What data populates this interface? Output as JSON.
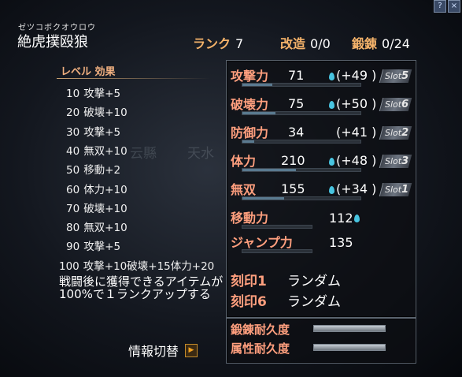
{
  "window": {
    "top_icons": [
      "?",
      "×"
    ],
    "background_text": [
      "天水",
      "云縣"
    ]
  },
  "header": {
    "reading": "ゼツコボクオウロウ",
    "item_name": "絶虎撲殴狼",
    "rank_label": "ランク",
    "rank_value": "7",
    "mod_label": "改造",
    "mod_value": "0/0",
    "forge_label": "鍛錬",
    "forge_value": "0/24"
  },
  "level_effects": {
    "title": "レベル 効果",
    "items": [
      {
        "level": "10",
        "effect": "攻撃+5"
      },
      {
        "level": "20",
        "effect": "破壊+10"
      },
      {
        "level": "30",
        "effect": "攻撃+5"
      },
      {
        "level": "40",
        "effect": "無双+10"
      },
      {
        "level": "50",
        "effect": "移動+2"
      },
      {
        "level": "60",
        "effect": "体力+10"
      },
      {
        "level": "70",
        "effect": "破壊+10"
      },
      {
        "level": "80",
        "effect": "無双+10"
      },
      {
        "level": "90",
        "effect": "攻撃+5"
      },
      {
        "level": "100",
        "effect": "攻撃+10破壊+15体力+20"
      }
    ]
  },
  "description": "戦闘後に獲得できるアイテムが100%で１ランクアップする",
  "info_switch": {
    "label": "情報切替",
    "icon": "arrow-right-icon"
  },
  "stats": [
    {
      "label": "攻撃力",
      "value": "71",
      "bonus": "(+49 )",
      "gem": true,
      "slot": "5",
      "bar": 0.25
    },
    {
      "label": "破壊力",
      "value": "75",
      "bonus": "(+50 )",
      "gem": true,
      "slot": "6",
      "bar": 0.28
    },
    {
      "label": "防御力",
      "value": "34",
      "bonus": "(+41 )",
      "gem": false,
      "slot": "2",
      "bar": 0.1
    },
    {
      "label": "体力",
      "value": "210",
      "bonus": "(+48 )",
      "gem": true,
      "slot": "3",
      "bar": 0.45
    },
    {
      "label": "無双",
      "value": "155",
      "bonus": "(+34 )",
      "gem": true,
      "slot": "1",
      "bar": 0.35
    }
  ],
  "slot_prefix": "Slot",
  "extra_stats": [
    {
      "label": "移動力",
      "value": "112",
      "gem": true
    },
    {
      "label": "ジャンプ力",
      "value": "135",
      "gem": false
    }
  ],
  "engravings": [
    {
      "label": "刻印1",
      "value": "ランダム"
    },
    {
      "label": "刻印6",
      "value": "ランダム"
    }
  ],
  "durability": [
    {
      "label": "鍛錬耐久度",
      "fill": 1.0
    },
    {
      "label": "属性耐久度",
      "fill": 1.0
    }
  ],
  "colors": {
    "stat_label": "#ff9f7e",
    "gem": "#48c4e0",
    "header_label": "#f5b36a"
  }
}
